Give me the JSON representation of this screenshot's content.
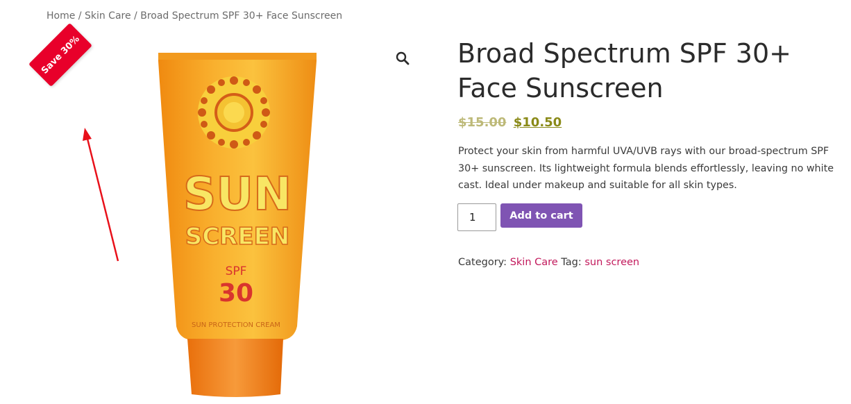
{
  "breadcrumb": {
    "home": "Home",
    "sep1": " / ",
    "category": "Skin Care",
    "sep2": " / ",
    "current": "Broad Spectrum SPF 30+ Face Sunscreen"
  },
  "badge": {
    "label": "Save 30%",
    "color": "#e8002a"
  },
  "product": {
    "title": "Broad Spectrum SPF 30+ Face Sunscreen",
    "price_old": "$15.00",
    "price_new": "$10.50",
    "description": "Protect your skin from harmful UVA/UVB rays with our broad-spectrum SPF 30+ sunscreen. Its lightweight formula blends effortlessly, leaving no white cast. Ideal under makeup and suitable for all skin types.",
    "image_text": {
      "line1": "SUN",
      "line2": "SCREEN",
      "spf_label": "SPF",
      "spf_value": "30",
      "tagline": "SUN PROTECTION CREAM"
    }
  },
  "cart": {
    "quantity": "1",
    "add_label": "Add to cart",
    "button_color": "#7f54b3"
  },
  "meta": {
    "category_label": "Category: ",
    "category": "Skin Care",
    "tag_label": " Tag: ",
    "tag": "sun screen",
    "link_color": "#c2185b"
  },
  "icons": {
    "zoom": "magnifier-icon",
    "annotation": "red-arrow"
  },
  "colors": {
    "annotation": "#e8101a",
    "tube": "#f7a320"
  }
}
